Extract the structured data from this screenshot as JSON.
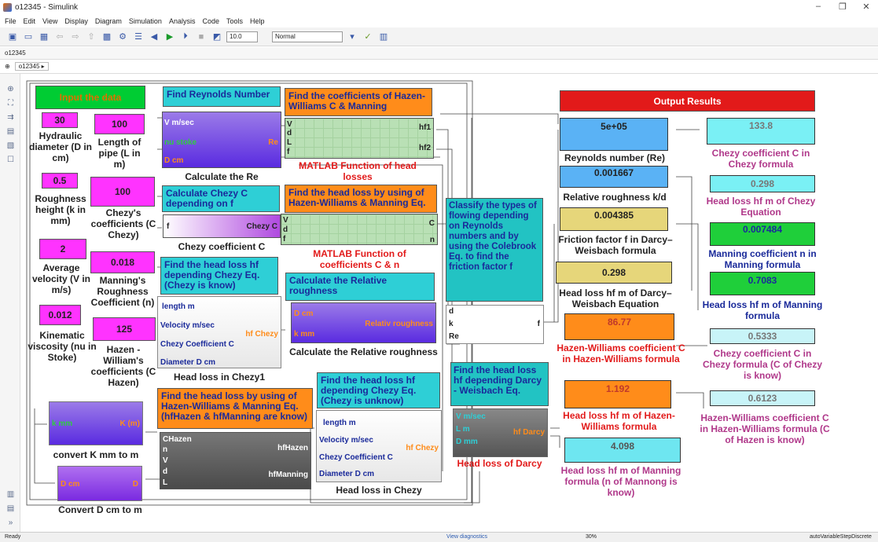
{
  "window": {
    "title": "o12345 - Simulink",
    "minimize": "–",
    "maximize": "❐",
    "close": "✕"
  },
  "menu": [
    "File",
    "Edit",
    "View",
    "Display",
    "Diagram",
    "Simulation",
    "Analysis",
    "Code",
    "Tools",
    "Help"
  ],
  "toolbar": {
    "stop_time": "10.0",
    "sim_mode": "Normal"
  },
  "tab": "o12345",
  "address": "o12345 ▸",
  "status": {
    "left": "Ready",
    "diag": "View diagnostics",
    "zoom": "30%",
    "solver": "autoVariableStepDiscrete"
  },
  "model": {
    "input_title": "Input the data",
    "output_title": "Output Results",
    "inputs": [
      {
        "value": "30",
        "label": "Hydraulic diameter (D in cm)"
      },
      {
        "value": "100",
        "label": "Length of pipe (L in m)"
      },
      {
        "value": "0.5",
        "label": "Roughness height (k in mm)"
      },
      {
        "value": "100",
        "label": "Chezy's coefficients (C Chezy)"
      },
      {
        "value": "2",
        "label": "Average velocity (V in m/s)"
      },
      {
        "value": "0.018",
        "label": "Manning's Roughness Coefficient (n)"
      },
      {
        "value": "0.012",
        "label": "Kinematic viscosity (nu in Stoke)"
      },
      {
        "value": "125",
        "label": "Hazen - William's coefficients (C Hazen)"
      }
    ],
    "reynolds": {
      "title": "Find Reynolds Number",
      "p1": "V m/sec",
      "p2": "nu stoke",
      "p3": "D cm",
      "out": "Re",
      "caption": "Calculate the Re"
    },
    "hazen_coef": {
      "title": "Find the coefficients of Hazen-Williams C & Manning",
      "in": [
        "V",
        "d",
        "L",
        "f"
      ],
      "out1": "hf1",
      "out2": "hf2",
      "caption": "MATLAB Function of head losses"
    },
    "chezy_f": {
      "title": "Calculate Chezy C depending on f",
      "in": "f",
      "out": "Chezy C",
      "caption": "Chezy coefficient C"
    },
    "hazen_hl": {
      "title": "Find the head loss by using of Hazen-Williams & Manning Eq.",
      "in": [
        "V",
        "d",
        "f"
      ],
      "out1": "C",
      "out2": "n",
      "caption": "MATLAB Function of coefficients C & n"
    },
    "chezy1": {
      "title": "Find the head loss hf depending Chezy Eq. (Chezy is know)",
      "in": [
        "length m",
        "Velocity m/sec",
        "Chezy Coefficient C",
        "Diameter D cm"
      ],
      "out": "hf Chezy",
      "caption": "Head loss in Chezy1"
    },
    "rel_rough": {
      "title": "Calculate the Relative roughness",
      "in1": "D cm",
      "in2": "k mm",
      "out": "Relativ roughness",
      "caption": "Calculate the Relative roughness"
    },
    "classify": {
      "title": "Classify the types of flowing depending on Reynolds numbers and by using the Colebrook Eq. to find the friction factor f",
      "in": [
        "d",
        "k",
        "Re"
      ],
      "out": "f"
    },
    "convK": {
      "in": "k mm",
      "out": "K (m)",
      "caption": "convert K mm to m"
    },
    "convD": {
      "in": "D cm",
      "out": "D",
      "caption": "Convert D cm to m"
    },
    "hazen2": {
      "title": "Find the head loss by using of Hazen-Williams & Manning Eq. (hfHazen & hfManning are know)",
      "in": [
        "CHazen",
        "n",
        "V",
        "d",
        "L"
      ],
      "out1": "hfHazen",
      "out2": "hfManning"
    },
    "chezy2": {
      "title": "Find the head loss hf depending Chezy Eq. (Chezy is unknow)",
      "in": [
        "length m",
        "Velocity m/sec",
        "Chezy Coefficient C",
        "Diameter D cm"
      ],
      "out": "hf Chezy",
      "caption": "Head loss in Chezy"
    },
    "darcy": {
      "title": "Find the head loss hf depending Darcy - Weisbach Eq.",
      "in": [
        "V m/sec",
        "L m",
        "D mm"
      ],
      "out": "hf Darcy",
      "caption": "Head loss of Darcy"
    },
    "results_mid": [
      {
        "value": "5e+05",
        "label": "Reynolds number (Re)"
      },
      {
        "value": "0.001667",
        "label": "Relative roughness k/d"
      },
      {
        "value": "0.004385",
        "label": "Friction factor f in Darcy–Weisbach formula"
      },
      {
        "value": "0.298",
        "label": "Head loss hf m of Darcy–Weisbach Equation"
      },
      {
        "value": "86.77",
        "label": "Hazen-Williams coefficient C in Hazen-Williams formula"
      },
      {
        "value": "1.192",
        "label": "Head loss hf m of Hazen-Williams formula"
      },
      {
        "value": "4.098",
        "label": "Head loss hf m of Manning formula (n of Mannong is know)"
      }
    ],
    "results_right": [
      {
        "value": "133.8",
        "label": "Chezy coefficient C in Chezy formula"
      },
      {
        "value": "0.298",
        "label": "Head loss hf m of Chezy Equation"
      },
      {
        "value": "0.007484",
        "label": "Manning coefficient n in Manning formula"
      },
      {
        "value": "0.7083",
        "label": "Head loss hf m of Manning formula"
      },
      {
        "value": "0.5333",
        "label": "Chezy coefficient C in Chezy formula (C of Chezy is know)"
      },
      {
        "value": "0.6123",
        "label": "Hazen-Williams coefficient C in Hazen-Williams formula (C of Hazen is know)"
      }
    ]
  }
}
